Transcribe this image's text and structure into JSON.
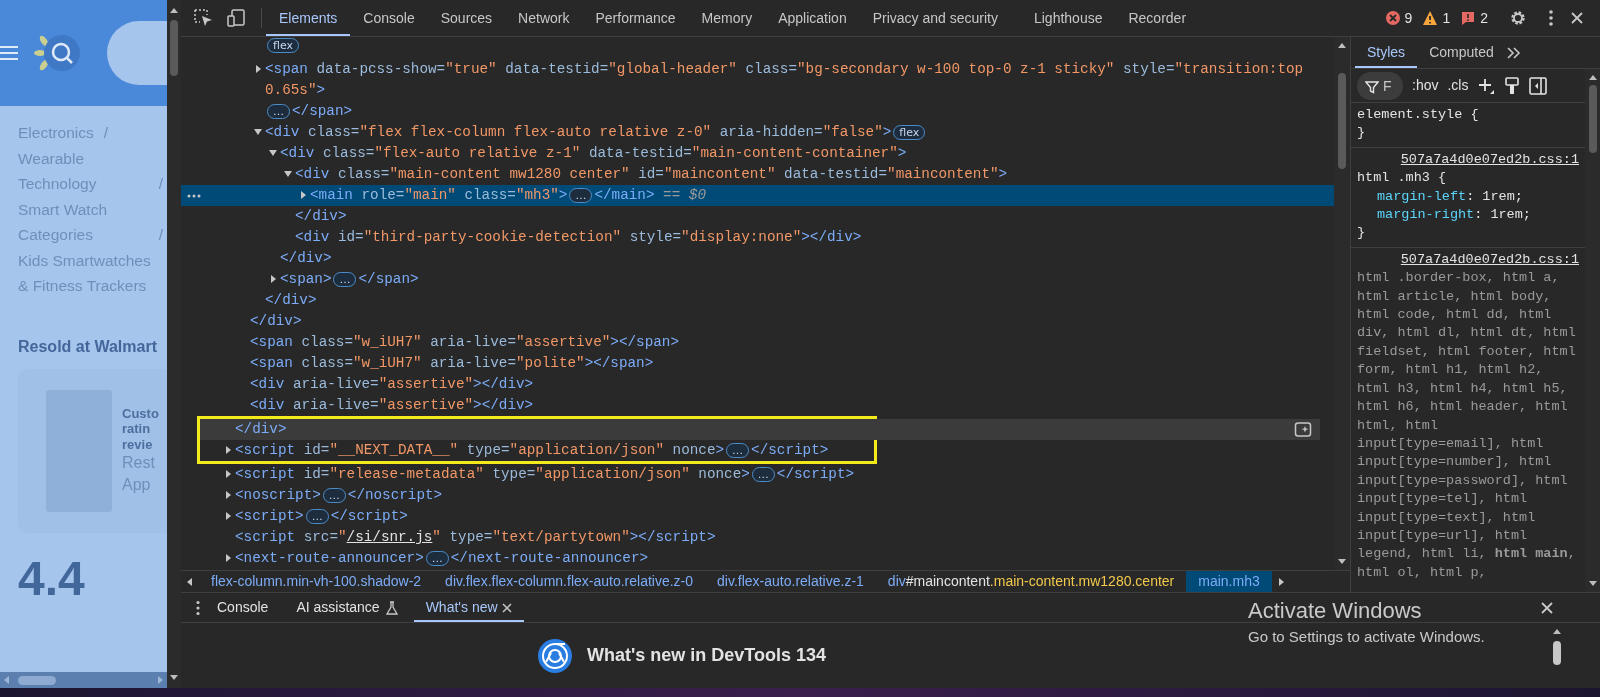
{
  "web_page": {
    "breadcrumb": [
      {
        "label": "Electronics",
        "separator": "/"
      },
      {
        "label": "Wearable Technology",
        "separator": "/"
      },
      {
        "label": "Smart Watch Categories",
        "separator": "/"
      },
      {
        "label": "Kids Smartwatches & Fitness Trackers"
      }
    ],
    "section_title": "Resold at Walmart",
    "product_title_lines": [
      "Custo",
      "ratin",
      "revie"
    ],
    "product_text_lines": [
      "Rest",
      "App"
    ],
    "rating": "4.4"
  },
  "toolbar": {
    "tabs": [
      {
        "label": "Elements",
        "selected": true
      },
      {
        "label": "Console",
        "selected": false
      },
      {
        "label": "Sources",
        "selected": false
      },
      {
        "label": "Network",
        "selected": false
      },
      {
        "label": "Performance",
        "selected": false
      },
      {
        "label": "Memory",
        "selected": false
      },
      {
        "label": "Application",
        "selected": false
      },
      {
        "label": "Privacy and security",
        "selected": false
      },
      {
        "label": "Lighthouse",
        "selected": false
      },
      {
        "label": "Recorder",
        "selected": false
      }
    ],
    "errors": "9",
    "warnings": "1",
    "issues": "2"
  },
  "elements_tree": {
    "nodes": [
      {
        "children": [
          {
            "children": [
              {
                "selected": false,
                "parts": [
                  {
                    "kind": "badge",
                    "text": "flex"
                  }
                ]
              },
              {
                "selected": false,
                "expanded": false,
                "parts": [
                  {
                    "kind": "markup",
                    "text": "<span data-pcss-show=\"true\" data-testid=\"global-header\" class=\"bg-secondary w-100 top-0 z-1 sticky\" style=\"transition:top 0.65s\">"
                  },
                  {
                    "kind": "ellipsis",
                    "text": "…"
                  },
                  {
                    "kind": "markup",
                    "text": "</span>"
                  }
                ]
              },
              {
                "selected": false,
                "expanded": true,
                "parts": [
                  {
                    "kind": "markup",
                    "text": "<div class=\"flex flex-column flex-auto relative z-0\" aria-hidden=\"false\">"
                  },
                  {
                    "kind": "badge",
                    "text": "flex"
                  }
                ],
                "children": [
                  {
                    "selected": false,
                    "expanded": true,
                    "parts": [
                      {
                        "kind": "markup",
                        "text": "<div class=\"flex-auto relative z-1\" data-testid=\"main-content-container\">"
                      }
                    ],
                    "children": [
                      {
                        "selected": false,
                        "expanded": true,
                        "parts": [
                          {
                            "kind": "markup",
                            "text": "<div class=\"main-content mw1280 center\" id=\"maincontent\" data-testid=\"maincontent\">"
                          }
                        ],
                        "children": [
                          {
                            "selected": true,
                            "expanded": false,
                            "parts": [
                              {
                                "kind": "markup",
                                "text": "<main role=\"main\" class=\"mh3\">"
                              },
                              {
                                "kind": "ellipsis",
                                "text": "…"
                              },
                              {
                                "kind": "markup",
                                "text": "</main>"
                              },
                              {
                                "kind": "note",
                                "text": " == $0"
                              }
                            ]
                          }
                        ],
                        "close": {
                          "parts": [
                            {
                              "kind": "markup",
                              "text": "</div>"
                            }
                          ]
                        }
                      },
                      {
                        "selected": false,
                        "parts": [
                          {
                            "kind": "markup",
                            "text": "<div id=\"third-party-cookie-detection\" style=\"display:none\"></div>"
                          }
                        ]
                      }
                    ],
                    "close": {
                      "parts": [
                        {
                          "kind": "markup",
                          "text": "</div>"
                        }
                      ]
                    }
                  },
                  {
                    "selected": false,
                    "expanded": false,
                    "parts": [
                      {
                        "kind": "markup",
                        "text": "<span>"
                      },
                      {
                        "kind": "ellipsis",
                        "text": "…"
                      },
                      {
                        "kind": "markup",
                        "text": "</span>"
                      }
                    ]
                  }
                ],
                "close": {
                  "parts": [
                    {
                      "kind": "markup",
                      "text": "</div>"
                    }
                  ]
                }
              }
            ],
            "close": {
              "parts": [
                {
                  "kind": "markup",
                  "text": "</div>"
                }
              ]
            }
          },
          {
            "selected": false,
            "parts": [
              {
                "kind": "markup",
                "text": "<span class=\"w_iUH7\" aria-live=\"assertive\"></span>"
              }
            ]
          },
          {
            "selected": false,
            "parts": [
              {
                "kind": "markup",
                "text": "<span class=\"w_iUH7\" aria-live=\"polite\"></span>"
              }
            ]
          },
          {
            "selected": false,
            "parts": [
              {
                "kind": "markup",
                "text": "<div aria-live=\"assertive\"></div>"
              }
            ]
          },
          {
            "selected": false,
            "parts": [
              {
                "kind": "markup",
                "text": "<div aria-live=\"assertive\"></div>"
              }
            ]
          }
        ],
        "close": {
          "parts": [
            {
              "kind": "markup",
              "text": "</div>"
            }
          ],
          "hovered": true,
          "boxed": true
        }
      },
      {
        "selected": false,
        "expanded": false,
        "boxed": true,
        "parts": [
          {
            "kind": "markup",
            "text": "<script id=\"__NEXT_DATA__\" type=\"application/json\" nonce>"
          },
          {
            "kind": "ellipsis",
            "text": "…"
          },
          {
            "kind": "markup",
            "text": "</script>"
          }
        ]
      },
      {
        "selected": false,
        "expanded": false,
        "parts": [
          {
            "kind": "markup",
            "text": "<script id=\"release-metadata\" type=\"application/json\" nonce>"
          },
          {
            "kind": "ellipsis",
            "text": "…"
          },
          {
            "kind": "markup",
            "text": "</script>"
          }
        ]
      },
      {
        "selected": false,
        "expanded": false,
        "parts": [
          {
            "kind": "markup",
            "text": "<noscript>"
          },
          {
            "kind": "ellipsis",
            "text": "…"
          },
          {
            "kind": "markup",
            "text": "</noscript>"
          }
        ]
      },
      {
        "selected": false,
        "expanded": false,
        "parts": [
          {
            "kind": "markup",
            "text": "<script>"
          },
          {
            "kind": "ellipsis",
            "text": "…"
          },
          {
            "kind": "markup",
            "text": "</script>"
          }
        ]
      },
      {
        "selected": false,
        "parts": [
          {
            "kind": "markup",
            "text": "<script src=\""
          },
          {
            "kind": "link",
            "text": "/si/snr.js"
          },
          {
            "kind": "markup",
            "text": "\" type=\"text/partytown\"></script>"
          }
        ]
      },
      {
        "selected": false,
        "expanded": false,
        "parts": [
          {
            "kind": "markup",
            "text": "<next-route-announcer>"
          },
          {
            "kind": "ellipsis",
            "text": "…"
          },
          {
            "kind": "markup",
            "text": "</next-route-announcer>"
          }
        ]
      }
    ]
  },
  "breadcrumbs": [
    {
      "text": "flex-column.min-vh-100.shadow-2",
      "selected": false
    },
    {
      "text": "div.flex.flex-column.flex-auto.relative.z-0",
      "selected": false
    },
    {
      "text": "div.flex-auto.relative.z-1",
      "selected": false
    },
    {
      "text": "div#maincontent.main-content.mw1280.center",
      "selected": false
    },
    {
      "text": "main.mh3",
      "selected": true
    }
  ],
  "styles_panel": {
    "tabs": [
      {
        "label": "Styles",
        "selected": true
      },
      {
        "label": "Computed",
        "selected": false
      }
    ],
    "filter": {
      "placeholder": "F"
    },
    "toggles": [
      ":hov",
      ".cls"
    ],
    "rules": [
      {
        "selector": "element.style {",
        "close": "}"
      },
      {
        "source": "507a7a4d0e07ed2b.css:1",
        "selector": "html .mh3 {",
        "properties": [
          {
            "name": "margin-left",
            "colon": ":",
            "value": "1rem;"
          },
          {
            "name": "margin-right",
            "colon": ":",
            "value": "1rem;"
          }
        ],
        "close": "}"
      },
      {
        "source": "507a7a4d0e07ed2b.css:1",
        "selector": "html .border-box, html a, html article, html body, html code, html dd, html div, html dl, html dt, html fieldset, html footer, html form, html h1, html h2, html h3, html h4, html h5, html h6, html header, html html, html input[type=email], html input[type=number], html input[type=password], html input[type=tel], html input[type=text], html input[type=url], html legend, html li, **html main**, html ol, html p,"
      }
    ]
  },
  "drawer": {
    "tabs": [
      {
        "label": "Console",
        "selected": false,
        "kind": "plain"
      },
      {
        "label": "AI assistance",
        "selected": false,
        "kind": "experimental"
      },
      {
        "label": "What's new",
        "selected": true,
        "kind": "closable"
      }
    ],
    "heading": "What's new in DevTools 134"
  },
  "os_notice": {
    "title": "Activate Windows",
    "subtitle": "Go to Settings to activate Windows."
  }
}
